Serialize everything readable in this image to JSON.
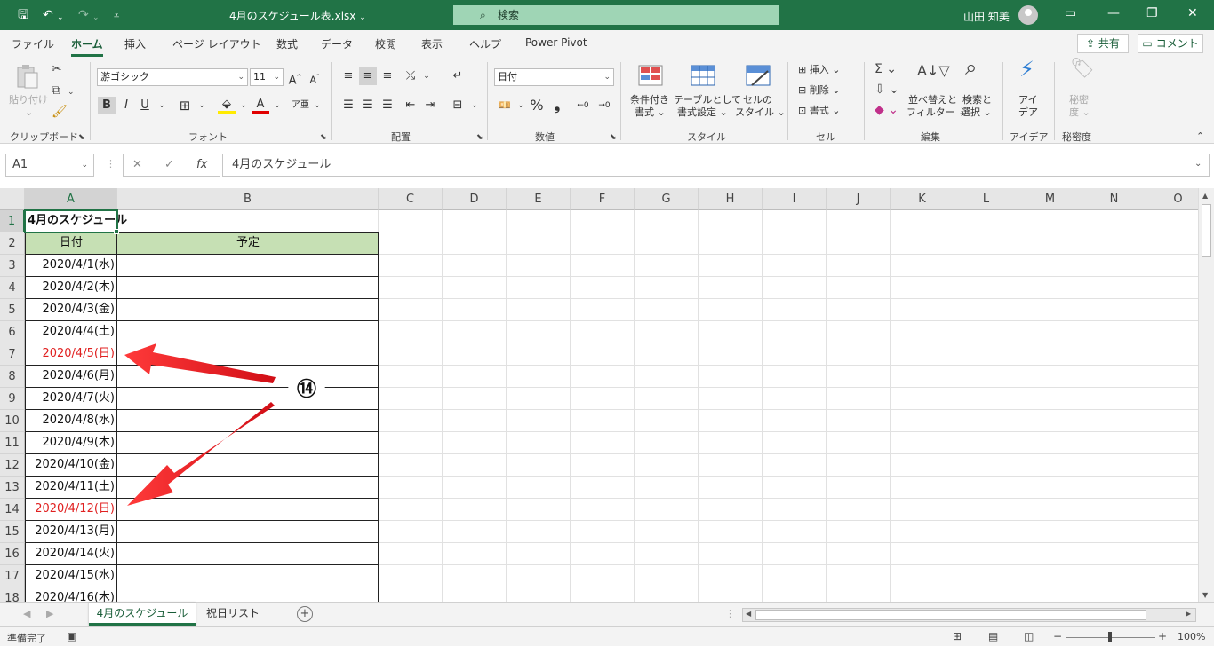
{
  "titlebar": {
    "doc_title": "4月のスケジュール表.xlsx",
    "doc_title_arrow": "⌄",
    "search_placeholder": "検索",
    "user_name": "山田 知美",
    "accent": "#217346"
  },
  "ribbon_tabs": [
    "ファイル",
    "ホーム",
    "挿入",
    "ページ レイアウト",
    "数式",
    "データ",
    "校閲",
    "表示",
    "ヘルプ",
    "Power Pivot"
  ],
  "share_label": "共有",
  "comment_label": "コメント",
  "ribbon": {
    "clipboard": {
      "paste": "貼り付け",
      "label": "クリップボード"
    },
    "font": {
      "name": "游ゴシック",
      "size": "11",
      "label": "フォント"
    },
    "alignment": {
      "label": "配置"
    },
    "number": {
      "format": "日付",
      "label": "数値"
    },
    "styles": {
      "cond_format": [
        "条件付き",
        "書式"
      ],
      "table_format": [
        "テーブルとして",
        "書式設定"
      ],
      "cell_style": [
        "セルの",
        "スタイル"
      ],
      "label": "スタイル"
    },
    "cells": {
      "insert": "挿入",
      "delete": "削除",
      "format": "書式",
      "label": "セル"
    },
    "editing": {
      "sort": [
        "並べ替えと",
        "フィルター"
      ],
      "find": [
        "検索と",
        "選択"
      ],
      "label": "編集"
    },
    "ideas": {
      "btn": [
        "アイ",
        "デア"
      ],
      "label": "アイデア"
    },
    "sensitivity": {
      "btn": [
        "秘密",
        "度"
      ],
      "label": "秘密度"
    }
  },
  "formula_bar": {
    "name_box": "A1",
    "formula": "4月のスケジュール",
    "fx": "fx"
  },
  "columns": [
    "A",
    "B",
    "C",
    "D",
    "E",
    "F",
    "G",
    "H",
    "I",
    "J",
    "K",
    "L",
    "M",
    "N",
    "O"
  ],
  "rows": [
    "1",
    "2",
    "3",
    "4",
    "5",
    "6",
    "7",
    "8",
    "9",
    "10",
    "11",
    "12",
    "13",
    "14",
    "15",
    "16",
    "17",
    "18"
  ],
  "sheet": {
    "title": "4月のスケジュール",
    "headers": [
      "日付",
      "予定"
    ],
    "dates": [
      {
        "text": "2020/4/1(水)",
        "sunday": false
      },
      {
        "text": "2020/4/2(木)",
        "sunday": false
      },
      {
        "text": "2020/4/3(金)",
        "sunday": false
      },
      {
        "text": "2020/4/4(土)",
        "sunday": false
      },
      {
        "text": "2020/4/5(日)",
        "sunday": true
      },
      {
        "text": "2020/4/6(月)",
        "sunday": false
      },
      {
        "text": "2020/4/7(火)",
        "sunday": false
      },
      {
        "text": "2020/4/8(水)",
        "sunday": false
      },
      {
        "text": "2020/4/9(木)",
        "sunday": false
      },
      {
        "text": "2020/4/10(金)",
        "sunday": false
      },
      {
        "text": "2020/4/11(土)",
        "sunday": false
      },
      {
        "text": "2020/4/12(日)",
        "sunday": true
      },
      {
        "text": "2020/4/13(月)",
        "sunday": false
      },
      {
        "text": "2020/4/14(火)",
        "sunday": false
      },
      {
        "text": "2020/4/15(水)",
        "sunday": false
      },
      {
        "text": "2020/4/16(木)",
        "sunday": false
      }
    ],
    "header_fill": "#c6e0b4",
    "sunday_color": "#e02020"
  },
  "annotation": {
    "label": "⑭",
    "arrow_color": "#e8141e"
  },
  "sheet_tabs": [
    "4月のスケジュール",
    "祝日リスト"
  ],
  "status": {
    "ready": "準備完了",
    "zoom": "100%"
  }
}
